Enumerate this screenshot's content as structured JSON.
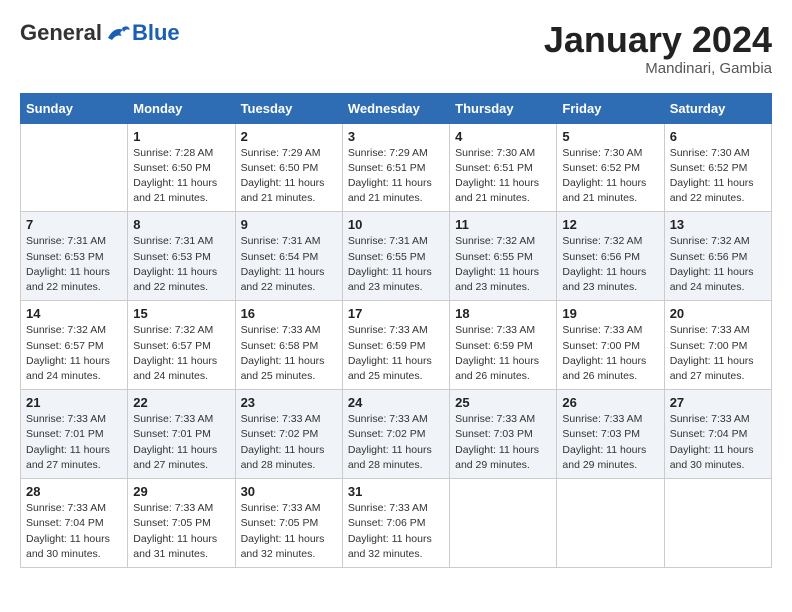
{
  "header": {
    "logo_general": "General",
    "logo_blue": "Blue",
    "month_title": "January 2024",
    "subtitle": "Mandinari, Gambia"
  },
  "weekdays": [
    "Sunday",
    "Monday",
    "Tuesday",
    "Wednesday",
    "Thursday",
    "Friday",
    "Saturday"
  ],
  "weeks": [
    [
      {
        "day": "",
        "info": ""
      },
      {
        "day": "1",
        "info": "Sunrise: 7:28 AM\nSunset: 6:50 PM\nDaylight: 11 hours and 21 minutes."
      },
      {
        "day": "2",
        "info": "Sunrise: 7:29 AM\nSunset: 6:50 PM\nDaylight: 11 hours and 21 minutes."
      },
      {
        "day": "3",
        "info": "Sunrise: 7:29 AM\nSunset: 6:51 PM\nDaylight: 11 hours and 21 minutes."
      },
      {
        "day": "4",
        "info": "Sunrise: 7:30 AM\nSunset: 6:51 PM\nDaylight: 11 hours and 21 minutes."
      },
      {
        "day": "5",
        "info": "Sunrise: 7:30 AM\nSunset: 6:52 PM\nDaylight: 11 hours and 21 minutes."
      },
      {
        "day": "6",
        "info": "Sunrise: 7:30 AM\nSunset: 6:52 PM\nDaylight: 11 hours and 22 minutes."
      }
    ],
    [
      {
        "day": "7",
        "info": "Sunrise: 7:31 AM\nSunset: 6:53 PM\nDaylight: 11 hours and 22 minutes."
      },
      {
        "day": "8",
        "info": "Sunrise: 7:31 AM\nSunset: 6:53 PM\nDaylight: 11 hours and 22 minutes."
      },
      {
        "day": "9",
        "info": "Sunrise: 7:31 AM\nSunset: 6:54 PM\nDaylight: 11 hours and 22 minutes."
      },
      {
        "day": "10",
        "info": "Sunrise: 7:31 AM\nSunset: 6:55 PM\nDaylight: 11 hours and 23 minutes."
      },
      {
        "day": "11",
        "info": "Sunrise: 7:32 AM\nSunset: 6:55 PM\nDaylight: 11 hours and 23 minutes."
      },
      {
        "day": "12",
        "info": "Sunrise: 7:32 AM\nSunset: 6:56 PM\nDaylight: 11 hours and 23 minutes."
      },
      {
        "day": "13",
        "info": "Sunrise: 7:32 AM\nSunset: 6:56 PM\nDaylight: 11 hours and 24 minutes."
      }
    ],
    [
      {
        "day": "14",
        "info": "Sunrise: 7:32 AM\nSunset: 6:57 PM\nDaylight: 11 hours and 24 minutes."
      },
      {
        "day": "15",
        "info": "Sunrise: 7:32 AM\nSunset: 6:57 PM\nDaylight: 11 hours and 24 minutes."
      },
      {
        "day": "16",
        "info": "Sunrise: 7:33 AM\nSunset: 6:58 PM\nDaylight: 11 hours and 25 minutes."
      },
      {
        "day": "17",
        "info": "Sunrise: 7:33 AM\nSunset: 6:59 PM\nDaylight: 11 hours and 25 minutes."
      },
      {
        "day": "18",
        "info": "Sunrise: 7:33 AM\nSunset: 6:59 PM\nDaylight: 11 hours and 26 minutes."
      },
      {
        "day": "19",
        "info": "Sunrise: 7:33 AM\nSunset: 7:00 PM\nDaylight: 11 hours and 26 minutes."
      },
      {
        "day": "20",
        "info": "Sunrise: 7:33 AM\nSunset: 7:00 PM\nDaylight: 11 hours and 27 minutes."
      }
    ],
    [
      {
        "day": "21",
        "info": "Sunrise: 7:33 AM\nSunset: 7:01 PM\nDaylight: 11 hours and 27 minutes."
      },
      {
        "day": "22",
        "info": "Sunrise: 7:33 AM\nSunset: 7:01 PM\nDaylight: 11 hours and 27 minutes."
      },
      {
        "day": "23",
        "info": "Sunrise: 7:33 AM\nSunset: 7:02 PM\nDaylight: 11 hours and 28 minutes."
      },
      {
        "day": "24",
        "info": "Sunrise: 7:33 AM\nSunset: 7:02 PM\nDaylight: 11 hours and 28 minutes."
      },
      {
        "day": "25",
        "info": "Sunrise: 7:33 AM\nSunset: 7:03 PM\nDaylight: 11 hours and 29 minutes."
      },
      {
        "day": "26",
        "info": "Sunrise: 7:33 AM\nSunset: 7:03 PM\nDaylight: 11 hours and 29 minutes."
      },
      {
        "day": "27",
        "info": "Sunrise: 7:33 AM\nSunset: 7:04 PM\nDaylight: 11 hours and 30 minutes."
      }
    ],
    [
      {
        "day": "28",
        "info": "Sunrise: 7:33 AM\nSunset: 7:04 PM\nDaylight: 11 hours and 30 minutes."
      },
      {
        "day": "29",
        "info": "Sunrise: 7:33 AM\nSunset: 7:05 PM\nDaylight: 11 hours and 31 minutes."
      },
      {
        "day": "30",
        "info": "Sunrise: 7:33 AM\nSunset: 7:05 PM\nDaylight: 11 hours and 32 minutes."
      },
      {
        "day": "31",
        "info": "Sunrise: 7:33 AM\nSunset: 7:06 PM\nDaylight: 11 hours and 32 minutes."
      },
      {
        "day": "",
        "info": ""
      },
      {
        "day": "",
        "info": ""
      },
      {
        "day": "",
        "info": ""
      }
    ]
  ]
}
